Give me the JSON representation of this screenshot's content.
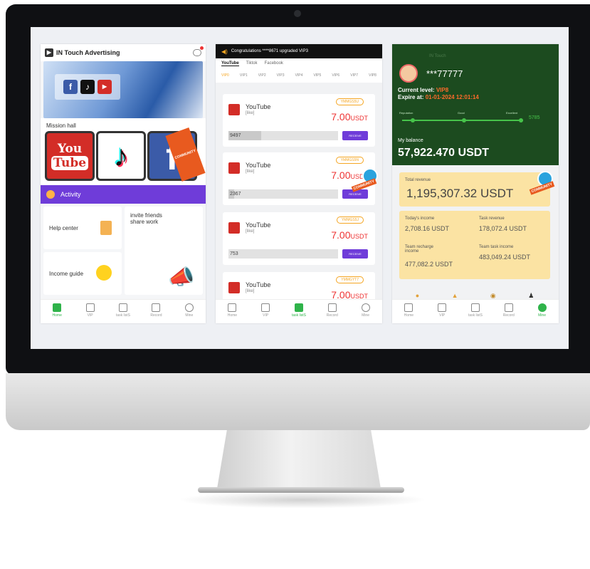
{
  "phone1": {
    "title": "IN Touch Advertising",
    "banner_labels": [
      "Facebook",
      "Tiktok",
      "YouTube"
    ],
    "mission_hall": "Mission hall",
    "app_youtube_top": "You",
    "app_youtube_bottom": "Tube",
    "app_tiktok": "♪",
    "app_facebook": "f",
    "activity": "Activity",
    "help_center": "Help center",
    "invite_friends": "invite friends share work",
    "income_guide": "Income guide",
    "community": "COMMUNITY",
    "tabs": [
      "Home",
      "VIP",
      "task\nlistS",
      "Record",
      "Mine"
    ]
  },
  "phone2": {
    "notice": "Congratulations ****8671 upgraded VIP3",
    "platforms": [
      "YouTube",
      "Tiktok",
      "Facebook"
    ],
    "vip_levels": [
      "VIP0",
      "VIP1",
      "VIP2",
      "VIP3",
      "VIP4",
      "VIP5",
      "VIP6",
      "VIP7",
      "VIP8"
    ],
    "tasks": [
      {
        "name": "YouTube",
        "sub": "[like]",
        "badge": "YMMGS5U",
        "price": "7.00",
        "unit": "USDT",
        "progress": "9497",
        "fill": 0.3,
        "button": "RECEIVE"
      },
      {
        "name": "YouTube",
        "sub": "[like]",
        "badge": "YMMGS5N",
        "price": "7.00",
        "unit": "USDT",
        "progress": "2367",
        "fill": 0.05,
        "button": "RECEIVE"
      },
      {
        "name": "YouTube",
        "sub": "[like]",
        "badge": "YMMGS5J",
        "price": "7.00",
        "unit": "USDT",
        "progress": "753",
        "fill": 0.0,
        "button": "RECEIVE"
      },
      {
        "name": "YouTube",
        "sub": "[like]",
        "badge": "YMMGYT7",
        "price": "7.00",
        "unit": "USDT",
        "progress": "",
        "fill": 0.0,
        "button": "RECEIVE"
      }
    ],
    "tabs": [
      "Home",
      "VIP",
      "task\nlistS",
      "Record",
      "Mine"
    ]
  },
  "phone3": {
    "brand": "IN Touch",
    "username": "***77777",
    "current_level_label": "Current level:",
    "current_level": "VIP8",
    "expire_label": "Expire at:",
    "expire": "01-01-2024 12:01:14",
    "track_labels": [
      "Reputation",
      "Good",
      "Excellent"
    ],
    "track_value": "5785",
    "balance_label": "My balance",
    "balance": "57,922.470 USDT",
    "total_revenue_label": "Total revenue",
    "total_revenue": "1,195,307.32 USDT",
    "todays_income_label": "Today's income",
    "todays_income": "2,708.16 USDT",
    "task_revenue_label": "Task revenue",
    "task_revenue": "178,072.4 USDT",
    "team_recharge_label": "Team recharge income",
    "team_recharge": "477,082.2 USDT",
    "team_task_label": "Team task income",
    "team_task": "483,049.24 USDT",
    "tabs": [
      "Home",
      "VIP",
      "task\nlistS",
      "Record",
      "Mine"
    ]
  },
  "colors": {
    "purple": "#6f3cd9",
    "green_header": "#1c4b1f",
    "price_red": "#e33333",
    "active_tab_green": "#2fb34a",
    "income_yellow": "#fbe3a3"
  }
}
